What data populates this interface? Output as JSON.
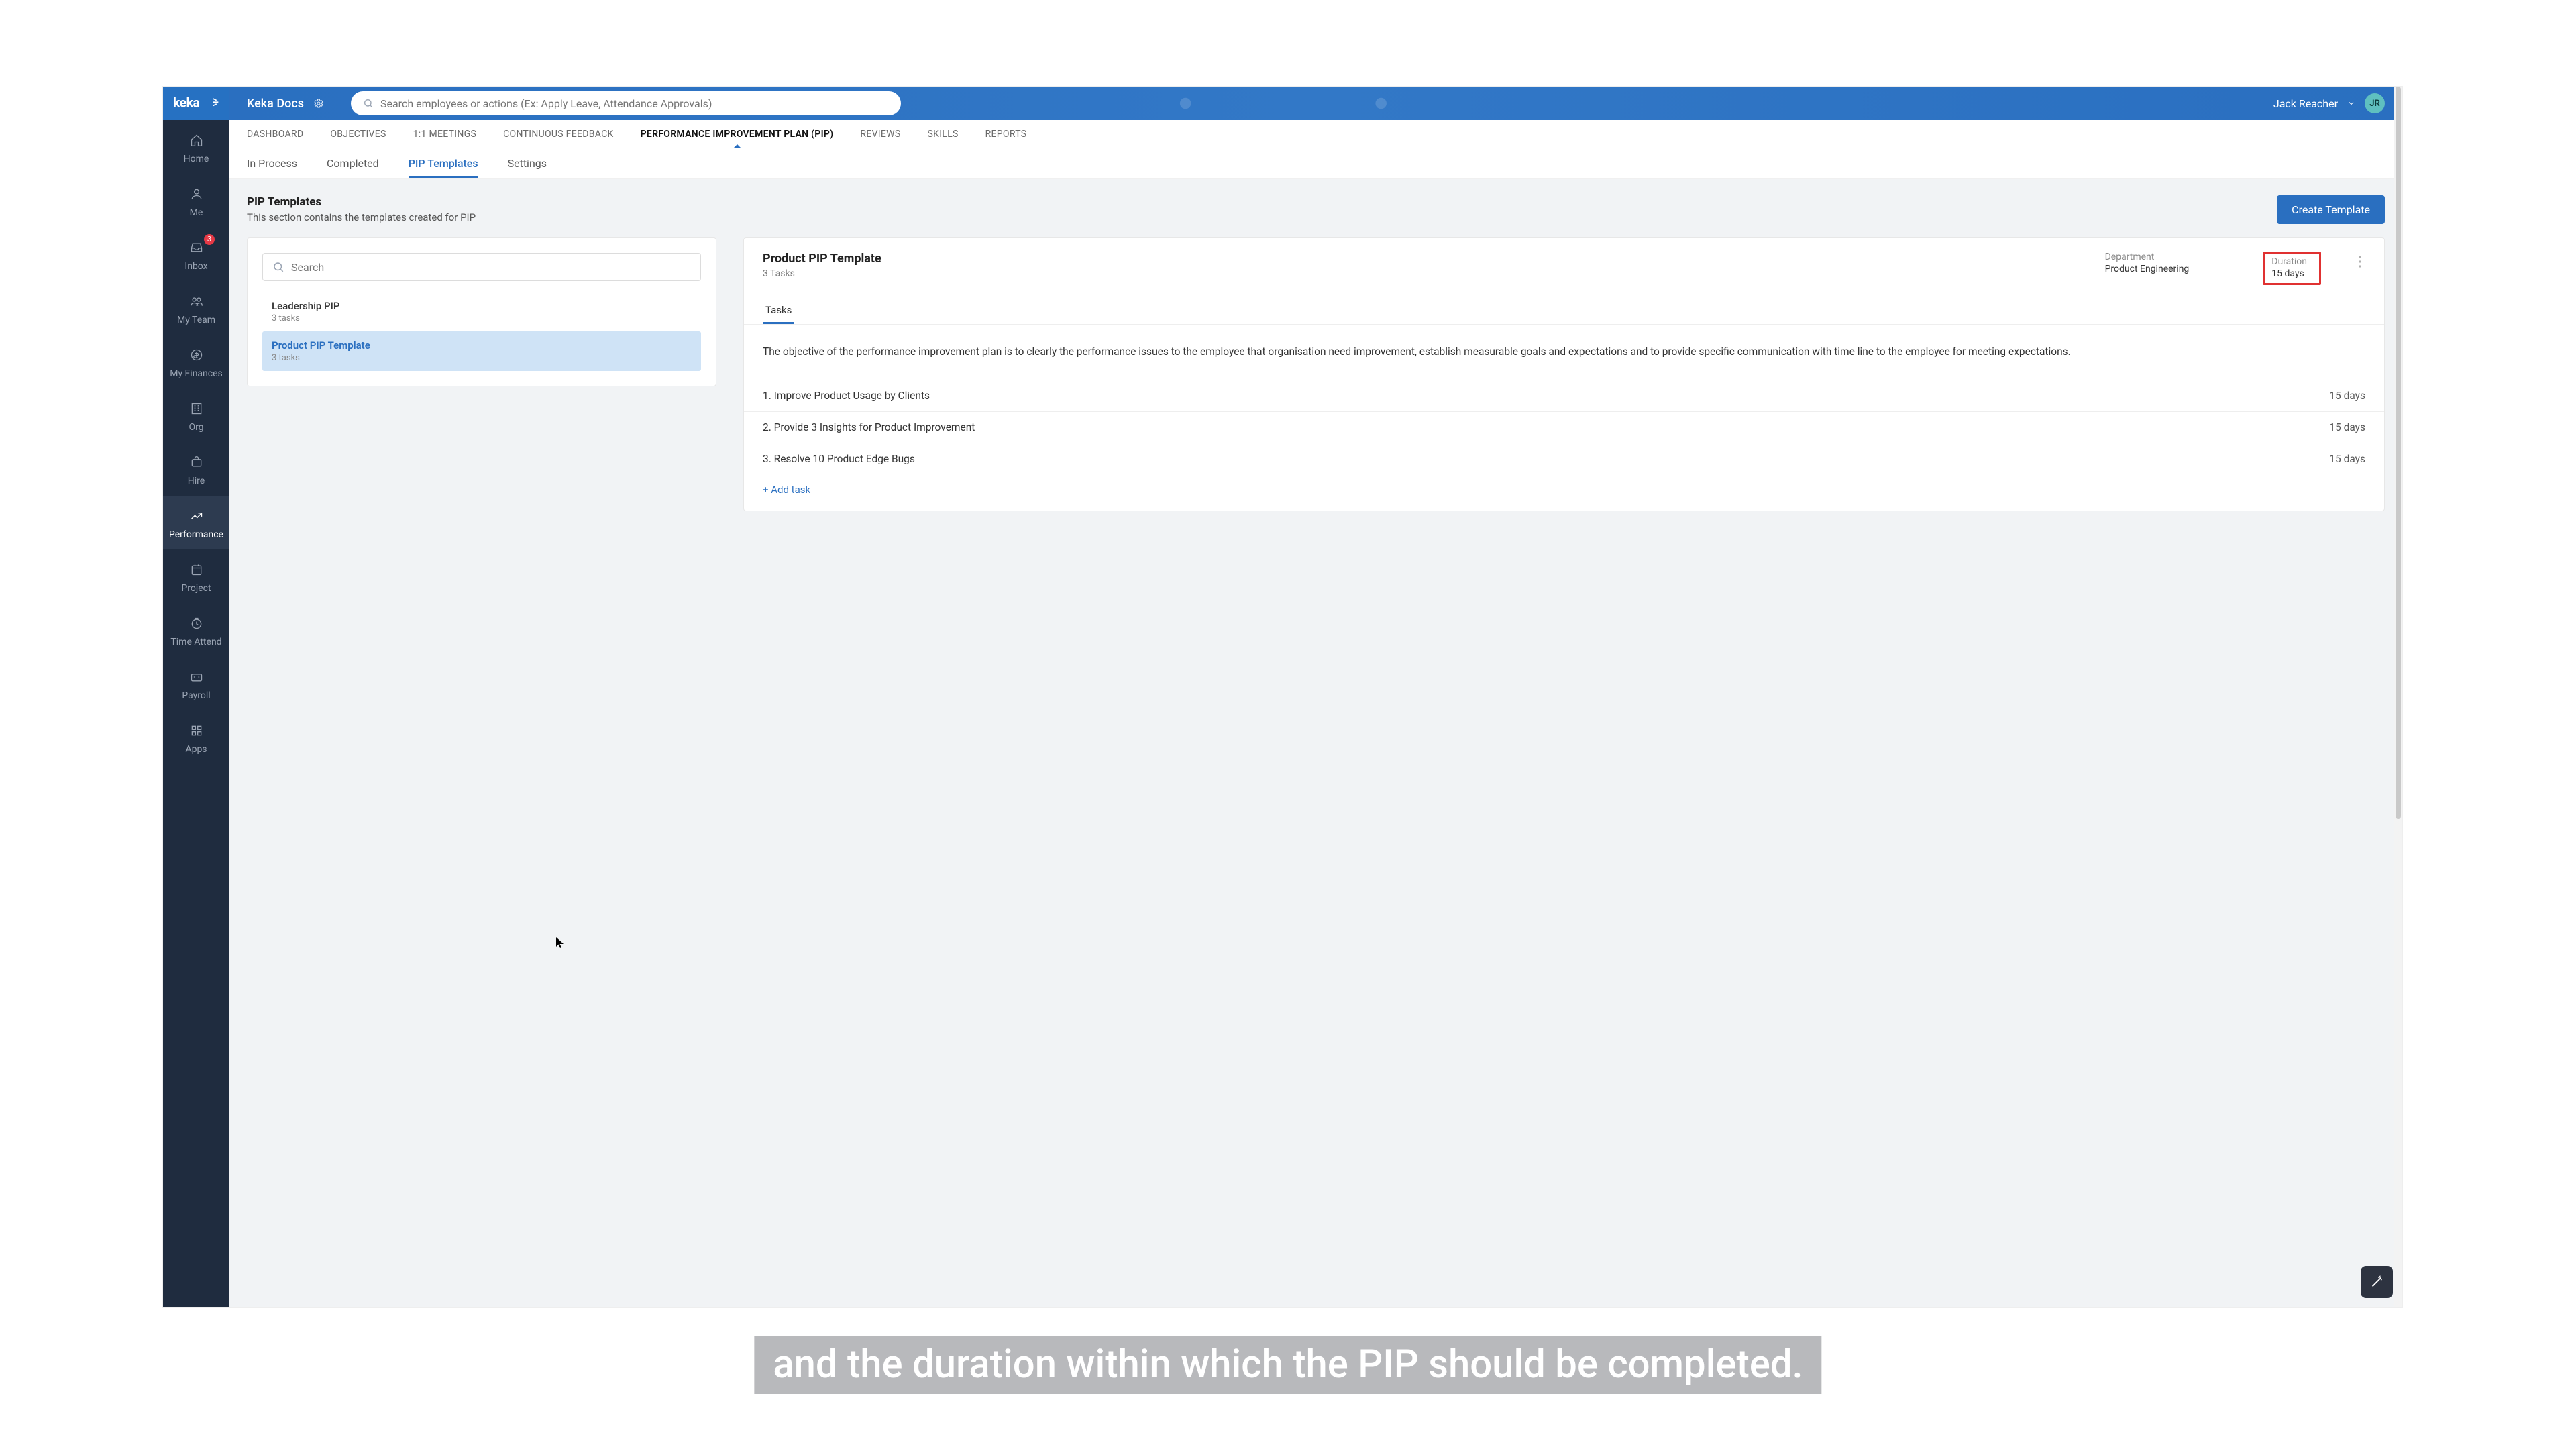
{
  "workspace": "Keka Docs",
  "search_placeholder": "Search employees or actions (Ex: Apply Leave, Attendance Approvals)",
  "user": {
    "name": "Jack Reacher",
    "initials": "JR"
  },
  "sidebar": {
    "items": [
      {
        "label": "Home"
      },
      {
        "label": "Me"
      },
      {
        "label": "Inbox",
        "badge": "3"
      },
      {
        "label": "My Team"
      },
      {
        "label": "My Finances"
      },
      {
        "label": "Org"
      },
      {
        "label": "Hire"
      },
      {
        "label": "Performance"
      },
      {
        "label": "Project"
      },
      {
        "label": "Time Attend"
      },
      {
        "label": "Payroll"
      },
      {
        "label": "Apps"
      }
    ]
  },
  "primary_tabs": [
    "DASHBOARD",
    "OBJECTIVES",
    "1:1 MEETINGS",
    "CONTINUOUS FEEDBACK",
    "PERFORMANCE IMPROVEMENT PLAN (PIP)",
    "REVIEWS",
    "SKILLS",
    "REPORTS"
  ],
  "primary_tab_active": 4,
  "sub_tabs": [
    "In Process",
    "Completed",
    "PIP Templates",
    "Settings"
  ],
  "sub_tab_active": 2,
  "page": {
    "title": "PIP Templates",
    "subtitle": "This section contains the templates created for PIP",
    "create_btn": "Create Template"
  },
  "list_search_placeholder": "Search",
  "templates": [
    {
      "name": "Leadership PIP",
      "meta": "3 tasks",
      "active": false
    },
    {
      "name": "Product PIP Template",
      "meta": "3 tasks",
      "active": true
    }
  ],
  "detail": {
    "title": "Product PIP Template",
    "subtitle": "3 Tasks",
    "dept_label": "Department",
    "dept_value": "Product Engineering",
    "duration_label": "Duration",
    "duration_value": "15 days",
    "tab": "Tasks",
    "description": "The objective of the performance improvement plan is to clearly the performance issues to the employee that organisation need improvement, establish measurable goals and expectations and to provide specific communication with time line to the employee for meeting expectations.",
    "tasks": [
      {
        "name": "1. Improve Product Usage by Clients",
        "duration": "15 days"
      },
      {
        "name": "2. Provide 3 Insights for Product Improvement",
        "duration": "15 days"
      },
      {
        "name": "3. Resolve 10 Product Edge Bugs",
        "duration": "15 days"
      }
    ],
    "add_task": "+ Add task"
  },
  "caption": "and the duration within which the PIP should be completed."
}
